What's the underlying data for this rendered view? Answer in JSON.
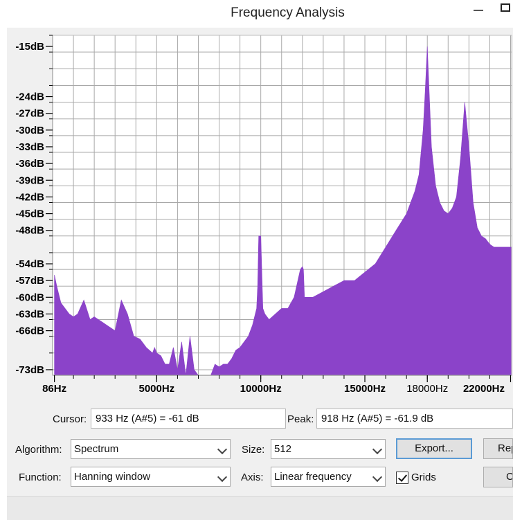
{
  "window": {
    "title": "Frequency Analysis"
  },
  "plot": {
    "y_ticks": [
      "-15dB",
      "-24dB",
      "-27dB",
      "-30dB",
      "-33dB",
      "-36dB",
      "-39dB",
      "-42dB",
      "-45dB",
      "-48dB",
      "-54dB",
      "-57dB",
      "-60dB",
      "-63dB",
      "-66dB",
      "-73dB"
    ],
    "x_ticks": [
      "86Hz",
      "5000Hz",
      "10000Hz",
      "15000Hz",
      "18000Hz",
      "22000Hz"
    ],
    "fill_color": "#8b43c9"
  },
  "chart_data": {
    "type": "area",
    "x_unit": "Hz",
    "y_unit": "dB",
    "xlim": [
      0,
      22050
    ],
    "ylim": [
      -74,
      -13
    ],
    "grid": true,
    "x": [
      86,
      200,
      400,
      600,
      800,
      1000,
      1200,
      1500,
      1800,
      2000,
      2200,
      2400,
      2600,
      2800,
      3000,
      3300,
      3600,
      3900,
      4200,
      4500,
      4800,
      4900,
      5000,
      5200,
      5400,
      5600,
      5800,
      6000,
      6200,
      6400,
      6600,
      6800,
      7000,
      7200,
      7400,
      7600,
      7800,
      8000,
      8200,
      8400,
      8600,
      8800,
      9000,
      9200,
      9400,
      9600,
      9800,
      9850,
      9900,
      10000,
      10100,
      10200,
      10400,
      10700,
      11000,
      11300,
      11600,
      11900,
      12000,
      12050,
      12100,
      12200,
      12500,
      13000,
      13500,
      14000,
      14500,
      15000,
      15500,
      16000,
      16500,
      17000,
      17200,
      17400,
      17600,
      17800,
      17900,
      18000,
      18100,
      18200,
      18400,
      18600,
      18800,
      19000,
      19200,
      19400,
      19600,
      19800,
      20000,
      20100,
      20200,
      20400,
      20600,
      20800,
      21000,
      21200,
      21500,
      22050
    ],
    "y": [
      -56,
      -58,
      -61,
      -62,
      -63,
      -63.5,
      -63,
      -60.5,
      -64,
      -63.5,
      -64,
      -64.5,
      -65,
      -65.5,
      -66,
      -60.5,
      -63,
      -67,
      -67.5,
      -69,
      -70,
      -69,
      -70,
      -70.5,
      -72,
      -72,
      -69,
      -73,
      -68,
      -74,
      -67,
      -73,
      -74,
      -74,
      -74,
      -74,
      -72,
      -72.5,
      -72,
      -72,
      -71,
      -69.5,
      -69,
      -68,
      -67,
      -65,
      -62,
      -58,
      -49,
      -49,
      -62,
      -63,
      -64,
      -63,
      -62,
      -62,
      -60,
      -55,
      -54.5,
      -55,
      -60,
      -60,
      -60,
      -59,
      -58,
      -57,
      -57,
      -55.5,
      -54,
      -51,
      -48,
      -45,
      -43,
      -41,
      -38,
      -30,
      -23,
      -15,
      -24,
      -33,
      -40,
      -43,
      -44.5,
      -45,
      -44,
      -42,
      -35,
      -25,
      -33,
      -38,
      -43,
      -47.5,
      -49,
      -49.5,
      -50.5,
      -51,
      -51,
      -51
    ]
  },
  "cursor": {
    "label": "Cursor:",
    "value": "933 Hz (A#5) = -61 dB"
  },
  "peak": {
    "label": "Peak:",
    "value": "918 Hz (A#5) = -61.9 dB"
  },
  "algorithm": {
    "label": "Algorithm:",
    "value": "Spectrum"
  },
  "size": {
    "label": "Size:",
    "value": "512"
  },
  "function": {
    "label": "Function:",
    "value": "Hanning window"
  },
  "axis": {
    "label": "Axis:",
    "value": "Linear frequency"
  },
  "grids": {
    "label": "Grids",
    "checked": true
  },
  "buttons": {
    "export": "Export...",
    "replot": "Replot",
    "close": "Close"
  }
}
